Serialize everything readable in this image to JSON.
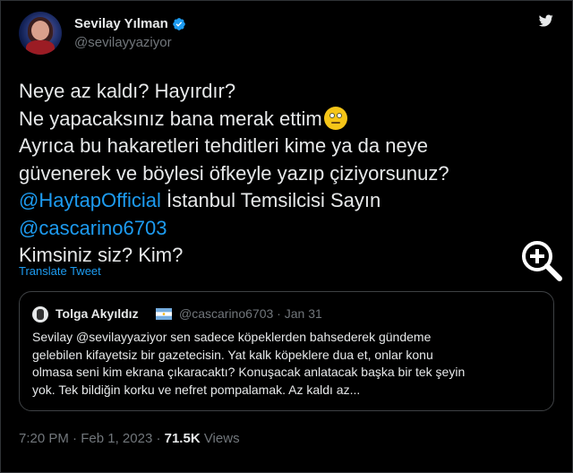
{
  "author": {
    "name": "Sevilay Yılman",
    "handle": "@sevilayyaziyor",
    "verified_color": "#1d9bf0"
  },
  "tweet": {
    "line1": "Neye az kaldı? Hayırdır?",
    "line2": "Ne yapacaksınız bana merak ettim",
    "line2_emoji": "face-with-rolling-eyes",
    "line3": "Ayrıca bu hakaretleri tehditleri kime ya da neye",
    "line4": "güvenerek ve böylesi öfkeyle yazıp çiziyorsunuz?",
    "mention1": "@HaytapOfficial",
    "line5_rest": " İstanbul Temsilcisi Sayın",
    "mention2": "@cascarino6703",
    "line7": "Kimsiniz siz? Kim?"
  },
  "translate_label": "Translate Tweet",
  "quoted": {
    "name": "Tolga Akyıldız",
    "flag": "argentina-flag",
    "handle": "@cascarino6703",
    "separator": "·",
    "date": "Jan 31",
    "lines": [
      "Sevilay @sevilayyaziyor sen sadece köpeklerden bahsederek gündeme",
      "gelebilen kifayetsiz bir gazetecisin. Yat kalk köpeklere dua et, onlar konu",
      "olmasa seni kim ekrana çıkaracaktı? Konuşacak anlatacak başka bir tek şeyin",
      "yok. Tek bildiğin korku ve nefret pompalamak. Az kaldı az..."
    ]
  },
  "footer": {
    "time": "7:20 PM",
    "separator": "·",
    "date": "Feb 1, 2023",
    "views_count": "71.5K",
    "views_label": "Views"
  },
  "colors": {
    "background": "#000000",
    "text": "#e7e9ea",
    "muted": "#71767b",
    "accent": "#1d9bf0"
  }
}
